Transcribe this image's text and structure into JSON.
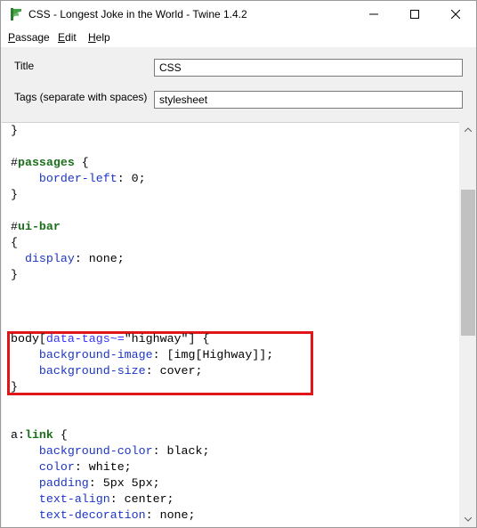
{
  "window": {
    "title": "CSS - Longest Joke in the World - Twine 1.4.2"
  },
  "menu": {
    "items": [
      {
        "accel": "P",
        "rest": "assage"
      },
      {
        "accel": "E",
        "rest": "dit"
      },
      {
        "accel": "H",
        "rest": "elp"
      }
    ]
  },
  "form": {
    "title_label": "Title",
    "title_value": "CSS",
    "tags_label": "Tags (separate with spaces)",
    "tags_value": "stylesheet"
  },
  "editor": {
    "lines": [
      [
        {
          "t": "}",
          "c": "plain"
        }
      ],
      [],
      [
        {
          "t": "#",
          "c": "plain"
        },
        {
          "t": "passages",
          "c": "sel"
        },
        {
          "t": " {",
          "c": "plain"
        }
      ],
      [
        {
          "t": "    ",
          "c": "plain"
        },
        {
          "t": "border-left",
          "c": "prop"
        },
        {
          "t": ": 0;",
          "c": "plain"
        }
      ],
      [
        {
          "t": "}",
          "c": "plain"
        }
      ],
      [],
      [
        {
          "t": "#",
          "c": "plain"
        },
        {
          "t": "ui-bar",
          "c": "sel"
        }
      ],
      [
        {
          "t": "{",
          "c": "plain"
        }
      ],
      [
        {
          "t": "  ",
          "c": "plain"
        },
        {
          "t": "display",
          "c": "prop"
        },
        {
          "t": ": none;",
          "c": "plain"
        }
      ],
      [
        {
          "t": "}",
          "c": "plain"
        }
      ],
      [],
      [],
      [],
      [
        {
          "t": "body[",
          "c": "plain"
        },
        {
          "t": "data-tags~=",
          "c": "attr"
        },
        {
          "t": "\"highway\"] {",
          "c": "plain"
        }
      ],
      [
        {
          "t": "    ",
          "c": "plain"
        },
        {
          "t": "background-image",
          "c": "prop"
        },
        {
          "t": ": [img[Highway]];",
          "c": "plain"
        }
      ],
      [
        {
          "t": "    ",
          "c": "plain"
        },
        {
          "t": "background-size",
          "c": "prop"
        },
        {
          "t": ": cover;",
          "c": "plain"
        }
      ],
      [
        {
          "t": "}",
          "c": "plain"
        }
      ],
      [],
      [],
      [
        {
          "t": "a:",
          "c": "plain"
        },
        {
          "t": "link",
          "c": "sel"
        },
        {
          "t": " {",
          "c": "plain"
        }
      ],
      [
        {
          "t": "    ",
          "c": "plain"
        },
        {
          "t": "background-color",
          "c": "prop"
        },
        {
          "t": ": black;",
          "c": "plain"
        }
      ],
      [
        {
          "t": "    ",
          "c": "plain"
        },
        {
          "t": "color",
          "c": "prop"
        },
        {
          "t": ": white;",
          "c": "plain"
        }
      ],
      [
        {
          "t": "    ",
          "c": "plain"
        },
        {
          "t": "padding",
          "c": "prop"
        },
        {
          "t": ": 5px 5px;",
          "c": "plain"
        }
      ],
      [
        {
          "t": "    ",
          "c": "plain"
        },
        {
          "t": "text-align",
          "c": "prop"
        },
        {
          "t": ": center;",
          "c": "plain"
        }
      ],
      [
        {
          "t": "    ",
          "c": "plain"
        },
        {
          "t": "text-decoration",
          "c": "prop"
        },
        {
          "t": ": none;",
          "c": "plain"
        }
      ]
    ]
  },
  "colors": {
    "highlight_box": "#e0161a",
    "selector": "#1a6f1a",
    "property": "#1c35c9"
  },
  "icons": [
    "twine-app-icon",
    "minimize-icon",
    "maximize-icon",
    "close-icon",
    "scroll-up-icon",
    "scroll-down-icon"
  ]
}
